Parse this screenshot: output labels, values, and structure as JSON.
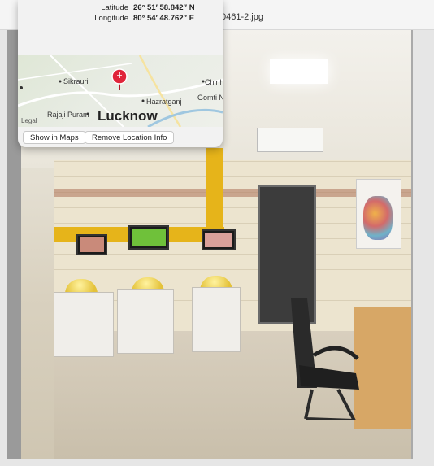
{
  "window": {
    "title_fragment": "0461-2.jpg"
  },
  "location": {
    "latitude_label": "Latitude",
    "latitude_value": "26° 51′ 58.842″ N",
    "longitude_label": "Longitude",
    "longitude_value": "80° 54′ 48.762″ E"
  },
  "map": {
    "city": "Lucknow",
    "places": [
      "Sikrauri",
      "Chinh",
      "Hazratganj",
      "Gomti N",
      "Rajaji Puram"
    ],
    "legal": "Legal",
    "pin_color": "#e0243a"
  },
  "buttons": {
    "show_in_maps": "Show in Maps",
    "remove_location": "Remove Location Info"
  }
}
